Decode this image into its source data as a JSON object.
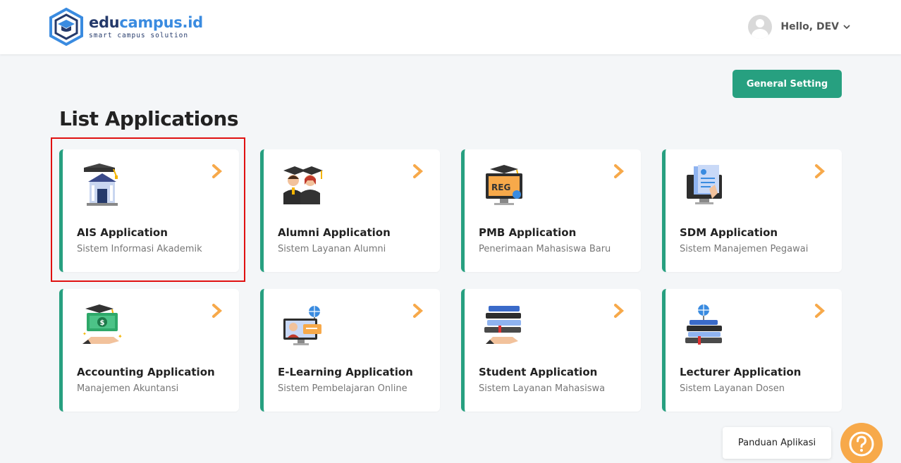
{
  "header": {
    "logo_main_a": "edu",
    "logo_main_b": "campus.id",
    "logo_tagline": "smart campus solution",
    "user_greeting": "Hello, DEV"
  },
  "toolbar": {
    "general_setting_label": "General Setting"
  },
  "page": {
    "title": "List Applications"
  },
  "apps": [
    {
      "title": "AIS Application",
      "subtitle": "Sistem Informasi Akademik",
      "icon": "campus-building-icon"
    },
    {
      "title": "Alumni Application",
      "subtitle": "Sistem Layanan Alumni",
      "icon": "graduates-icon"
    },
    {
      "title": "PMB Application",
      "subtitle": "Penerimaan Mahasiswa Baru",
      "icon": "registration-monitor-icon",
      "icon_text": "REG"
    },
    {
      "title": "SDM Application",
      "subtitle": "Sistem Manajemen Pegawai",
      "icon": "employee-document-icon"
    },
    {
      "title": "Accounting Application",
      "subtitle": "Manajemen Akuntansi",
      "icon": "money-hand-icon"
    },
    {
      "title": "E-Learning Application",
      "subtitle": "Sistem Pembelajaran Online",
      "icon": "online-learning-icon"
    },
    {
      "title": "Student Application",
      "subtitle": "Sistem Layanan Mahasiswa",
      "icon": "books-hand-icon"
    },
    {
      "title": "Lecturer Application",
      "subtitle": "Sistem Layanan Dosen",
      "icon": "books-globe-icon"
    }
  ],
  "help": {
    "guide_label": "Panduan Aplikasi"
  },
  "colors": {
    "accent": "#27a080",
    "arrow": "#f7a94a",
    "highlight": "#e01010",
    "brand_dark": "#253a6b",
    "brand_light": "#3a8be0"
  }
}
